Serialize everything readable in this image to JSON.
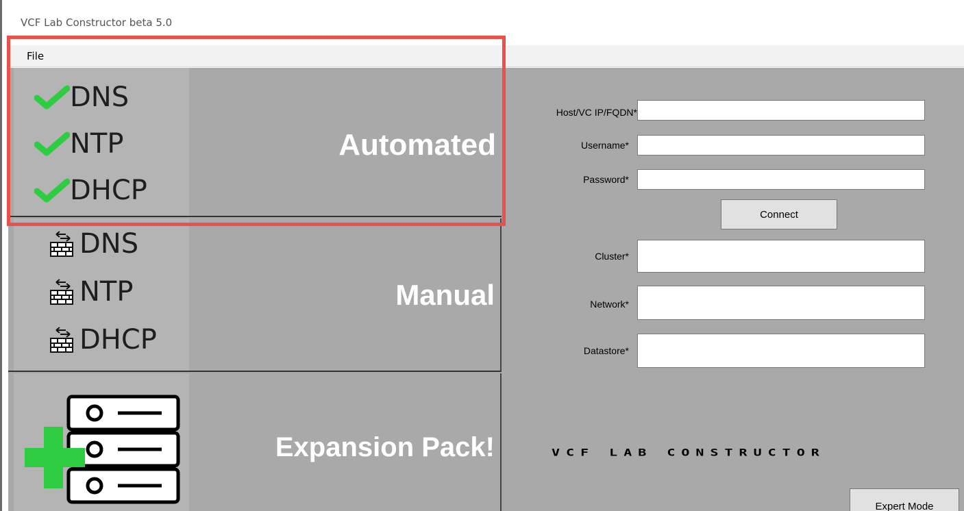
{
  "window": {
    "title": "VCF Lab Constructor beta 5.0"
  },
  "menu": {
    "file": "File"
  },
  "panels": {
    "automated": {
      "title": "Automated",
      "items": [
        "DNS",
        "NTP",
        "DHCP"
      ]
    },
    "manual": {
      "title": "Manual",
      "items": [
        "DNS",
        "NTP",
        "DHCP"
      ]
    },
    "expansion": {
      "title": "Expansion Pack!"
    }
  },
  "form": {
    "host_label": "Host/VC IP/FQDN*",
    "username_label": "Username*",
    "password_label": "Password*",
    "host_value": "",
    "username_value": "",
    "password_value": "",
    "connect_label": "Connect",
    "cluster_label": "Cluster*",
    "network_label": "Network*",
    "datastore_label": "Datastore*",
    "cluster_value": "",
    "network_value": "",
    "datastore_value": ""
  },
  "branding": "VCF LAB CONSTRUCTOR",
  "expert_mode_label": "Expert Mode",
  "colors": {
    "background": "#a9a9a9",
    "icon_column": "#b4b4b4",
    "check_green": "#2ecc40",
    "highlight_red": "#e8524a"
  }
}
